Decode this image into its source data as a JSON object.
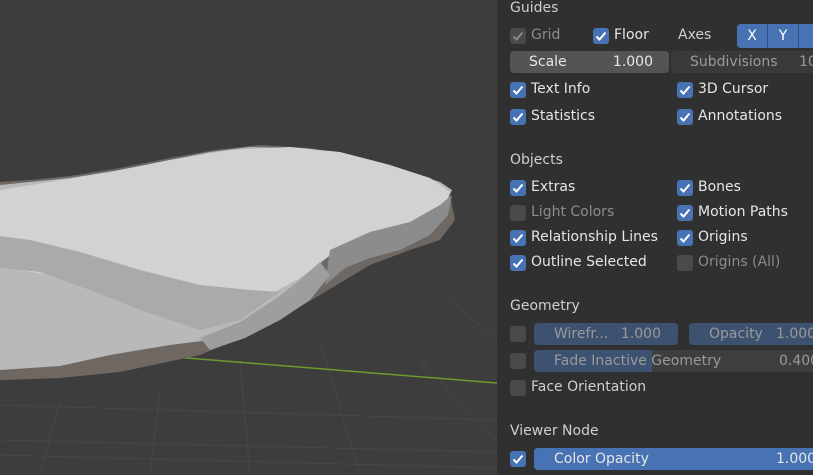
{
  "guides": {
    "title": "Guides",
    "grid": "Grid",
    "floor": "Floor",
    "axes": "Axes",
    "axis_x": "X",
    "axis_y": "Y",
    "scale_label": "Scale",
    "scale_value": "1.000",
    "subdivisions_label": "Subdivisions",
    "subdivisions_value": "10",
    "text_info": "Text Info",
    "cursor_3d": "3D Cursor",
    "statistics": "Statistics",
    "annotations": "Annotations"
  },
  "objects": {
    "title": "Objects",
    "extras": "Extras",
    "bones": "Bones",
    "light_colors": "Light Colors",
    "motion_paths": "Motion Paths",
    "relationship_lines": "Relationship Lines",
    "origins": "Origins",
    "outline_selected": "Outline Selected",
    "origins_all": "Origins (All)"
  },
  "geometry": {
    "title": "Geometry",
    "wireframe_label": "Wirefr...",
    "wireframe_value": "1.000",
    "opacity_label": "Opacity",
    "opacity_value": "1.000",
    "fade_label": "Fade Inactive Geometry",
    "fade_value": "0.400",
    "face_orientation": "Face Orientation"
  },
  "viewer_node": {
    "title": "Viewer Node",
    "color_opacity_label": "Color Opacity",
    "color_opacity_value": "1.000"
  },
  "colors": {
    "accent": "#4772b3",
    "panel_bg": "#303030",
    "viewport_bg": "#3d3d3d"
  }
}
